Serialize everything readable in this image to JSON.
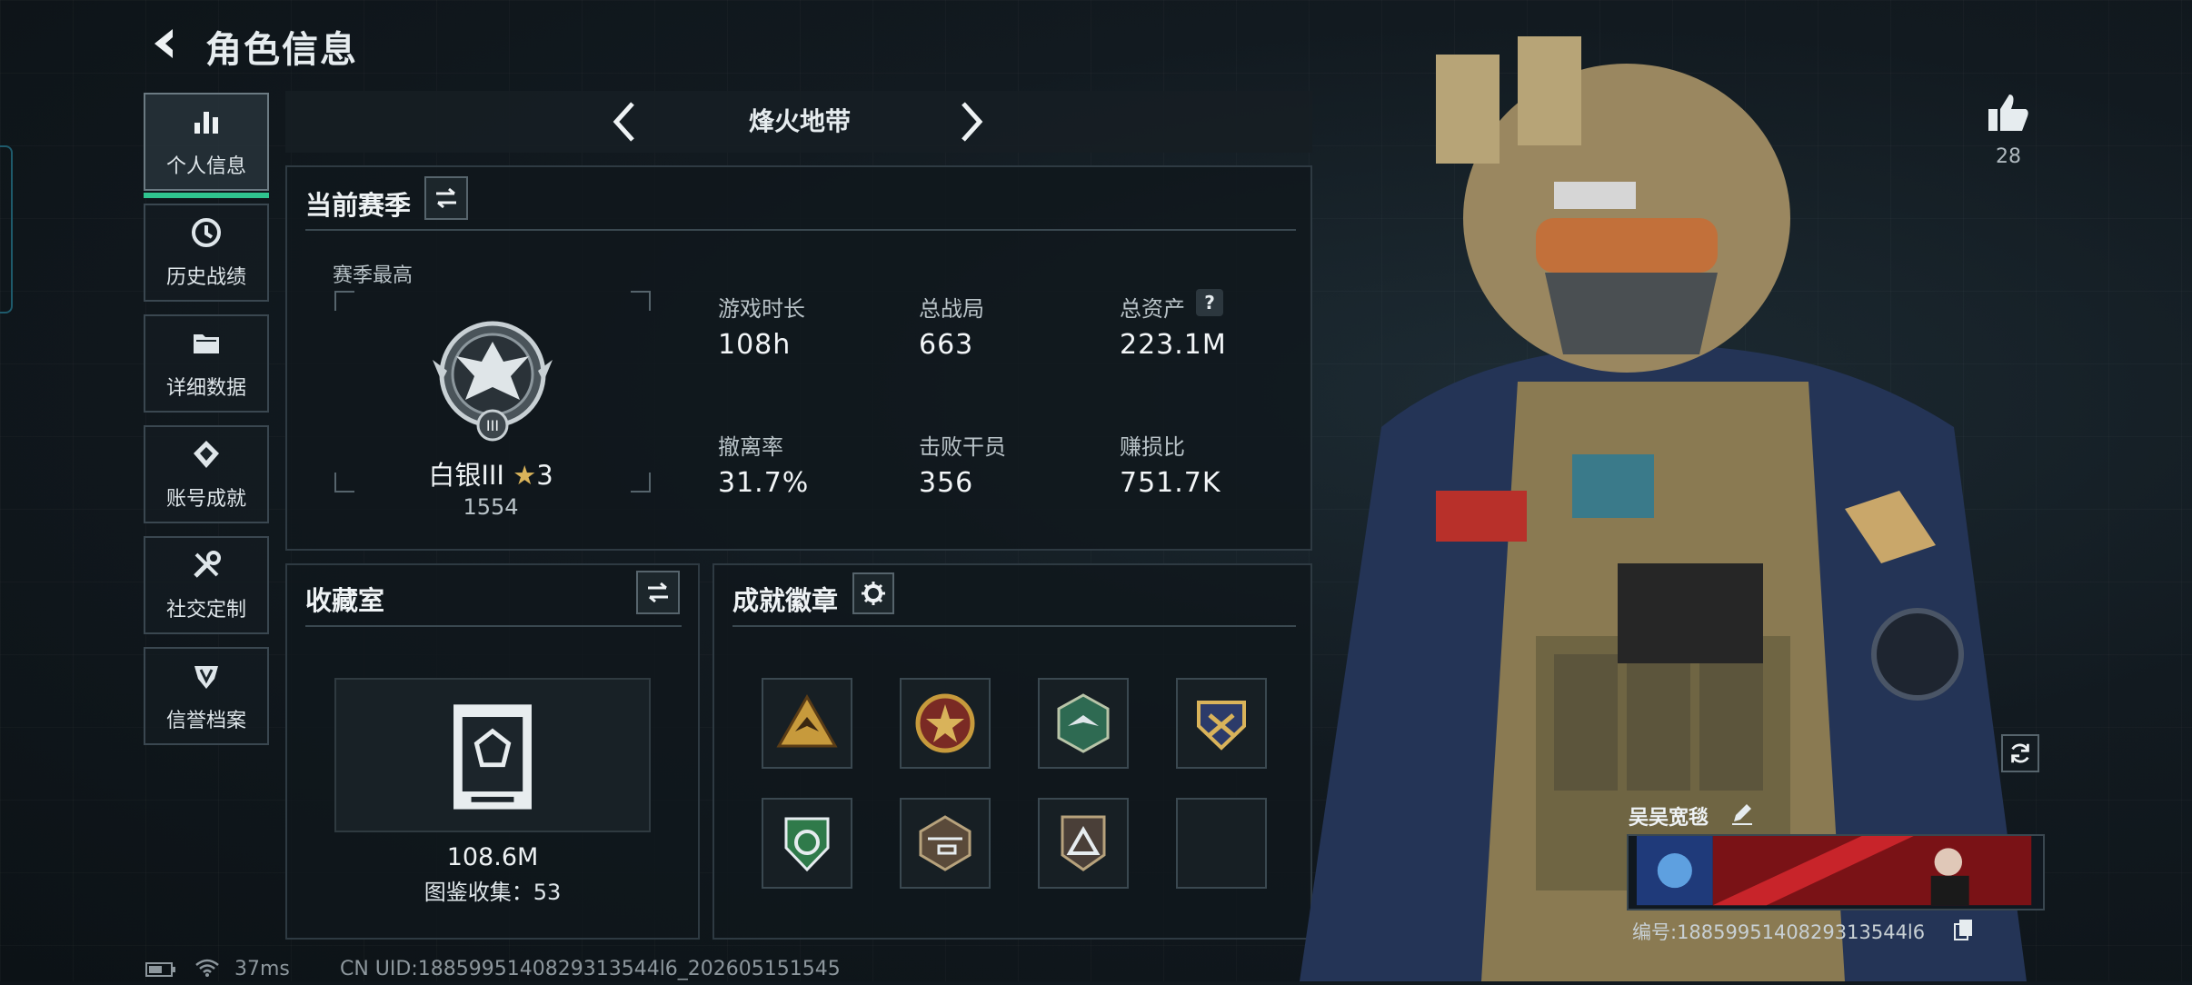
{
  "header": {
    "title": "角色信息"
  },
  "nav": {
    "items": [
      {
        "label": "个人信息",
        "icon": "bar-chart-icon"
      },
      {
        "label": "历史战绩",
        "icon": "clock-icon"
      },
      {
        "label": "详细数据",
        "icon": "folder-icon"
      },
      {
        "label": "账号成就",
        "icon": "achievement-icon"
      },
      {
        "label": "社交定制",
        "icon": "tools-icon"
      },
      {
        "label": "信誉档案",
        "icon": "shield-icon"
      }
    ],
    "active_index": 0
  },
  "mode": {
    "title": "烽火地带"
  },
  "season": {
    "title": "当前赛季",
    "best_label": "赛季最高",
    "rank_name": "白银III",
    "rank_stars": "3",
    "rank_score": "1554",
    "stats": [
      {
        "label": "游戏时长",
        "value": "108h"
      },
      {
        "label": "总战局",
        "value": "663"
      },
      {
        "label": "总资产",
        "value": "223.1M",
        "help": "?"
      },
      {
        "label": "撤离率",
        "value": "31.7%"
      },
      {
        "label": "击败干员",
        "value": "356"
      },
      {
        "label": "赚损比",
        "value": "751.7K"
      }
    ]
  },
  "collection": {
    "title": "收藏室",
    "value": "108.6M",
    "catalog_label": "图鉴收集：",
    "catalog_count": "53"
  },
  "badges": {
    "title": "成就徽章",
    "items": [
      "badge-triangle-eagle",
      "badge-star-seal",
      "badge-hexagon-bird",
      "badge-crest-emblem",
      "badge-green-shield",
      "badge-helicopter",
      "badge-triangle-mark",
      "badge-empty"
    ]
  },
  "profile": {
    "likes": "28",
    "player_name": "吴吴宽毯",
    "id_label": "编号:1885995140829313544l6"
  },
  "status_bar": {
    "ping": "37ms",
    "uid_text": "CN UID:1885995140829313544l6_202605151545"
  },
  "colors": {
    "accent": "#2fc48f",
    "panel_border": "#2e3a42",
    "gold": "#d9b35a"
  }
}
